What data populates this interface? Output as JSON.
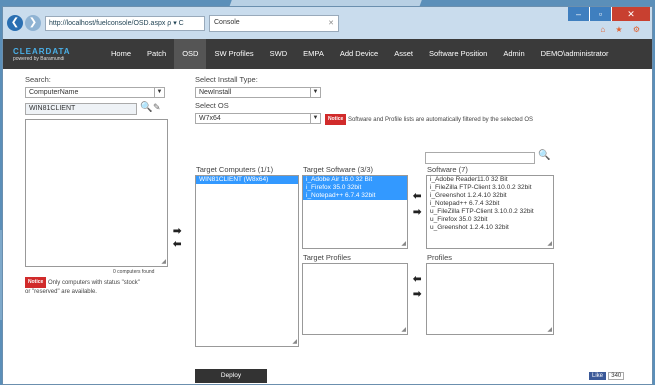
{
  "browser": {
    "address": "http://localhost/fuelconsole/OSD.aspx",
    "address_controls": "ρ ▾ C",
    "tab_title": "Console",
    "window_buttons": {
      "min": "‒",
      "max": "▫",
      "close": "✕"
    },
    "tool_icons": "⌂ ★ ⚙"
  },
  "app": {
    "brand": "CLEARDATA",
    "brand_sub": "powered by Baramundi",
    "nav": [
      "Home",
      "Patch",
      "OSD",
      "SW Profiles",
      "SWD",
      "EMPA",
      "Add Device",
      "Asset",
      "Software Position",
      "Admin",
      "DEMO\\administrator"
    ],
    "active_nav": "OSD"
  },
  "left": {
    "search_label": "Search:",
    "search_field_value": "ComputerName",
    "search_input_value": "WIN81CLIENT",
    "computers_found": "0 computers found",
    "notice_label": "Notice",
    "notice_text_1": "Only computers with status \"stock\"",
    "notice_text_2": "or \"reserved\" are available."
  },
  "install": {
    "type_label": "Select Install Type:",
    "type_value": "NewInstall",
    "os_label": "Select OS",
    "os_value": "W7x64",
    "notice_label": "Notice",
    "notice_text": "Software and Profile lists are automatically filtered by the selected OS"
  },
  "targets": {
    "computers_title": "Target Computers (1/1)",
    "computers": [
      "WIN81CLIENT (W8x64)"
    ],
    "software_title": "Target Software (3/3)",
    "software": [
      "i_Adobe Air 16.0 32 Bit",
      "i_Firefox 35.0 32bit",
      "i_Notepad++ 6.7.4 32bit"
    ],
    "profiles_title": "Target Profiles"
  },
  "available": {
    "software_title": "Software (7)",
    "software": [
      "i_Adobe Reader11.0 32 Bit",
      "i_FileZilla FTP-Client 3.10.0.2 32bit",
      "i_Greenshot 1.2.4.10 32bit",
      "i_Notepad++ 6.7.4 32bit",
      "u_FileZilla FTP-Client 3.10.0.2 32bit",
      "u_Firefox 35.0 32bit",
      "u_Greenshot 1.2.4.10 32bit"
    ],
    "profiles_title": "Profiles"
  },
  "arrows": {
    "right": "➡",
    "left": "⬅",
    "caret": "▼",
    "search": "🔍",
    "grip": "◢"
  },
  "footer": {
    "deploy_label": "Deploy",
    "like_label": "Like",
    "like_count": "340"
  }
}
